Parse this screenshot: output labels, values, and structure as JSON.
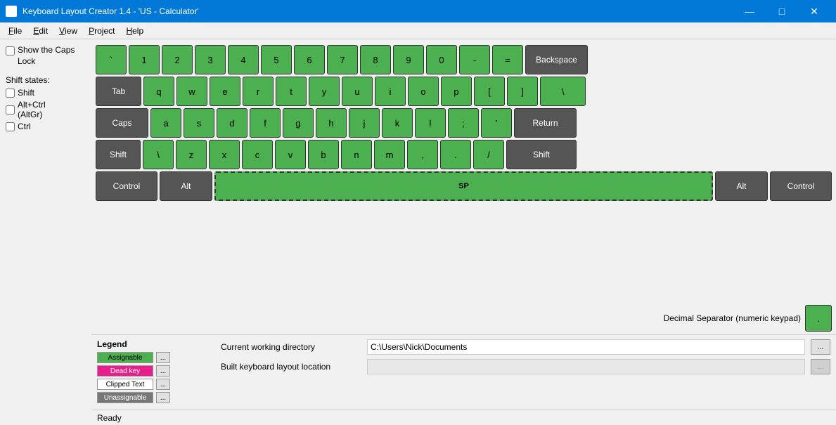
{
  "titleBar": {
    "title": "Keyboard Layout Creator 1.4 - 'US - Calculator'",
    "icon": "⌨",
    "minimize": "—",
    "maximize": "□",
    "close": "✕"
  },
  "menuBar": {
    "items": [
      {
        "label": "File",
        "underline": "F"
      },
      {
        "label": "Edit",
        "underline": "E"
      },
      {
        "label": "View",
        "underline": "V"
      },
      {
        "label": "Project",
        "underline": "P"
      },
      {
        "label": "Help",
        "underline": "H"
      }
    ]
  },
  "leftPanel": {
    "capsLock": {
      "label": "Show the Caps Lock",
      "checked": false
    },
    "shiftStates": {
      "title": "Shift states:",
      "items": [
        {
          "label": "Shift",
          "checked": false
        },
        {
          "label": "Alt+Ctrl (AltGr)",
          "checked": false
        },
        {
          "label": "Ctrl",
          "checked": false
        }
      ]
    }
  },
  "keyboard": {
    "rows": [
      {
        "keys": [
          {
            "label": "`",
            "type": "green",
            "size": "unit"
          },
          {
            "label": "1",
            "type": "green",
            "size": "unit"
          },
          {
            "label": "2",
            "type": "green",
            "size": "unit"
          },
          {
            "label": "3",
            "type": "green",
            "size": "unit"
          },
          {
            "label": "4",
            "type": "green",
            "size": "unit"
          },
          {
            "label": "5",
            "type": "green",
            "size": "unit"
          },
          {
            "label": "6",
            "type": "green",
            "size": "unit"
          },
          {
            "label": "7",
            "type": "green",
            "size": "unit"
          },
          {
            "label": "8",
            "type": "green",
            "size": "unit"
          },
          {
            "label": "9",
            "type": "green",
            "size": "unit"
          },
          {
            "label": "0",
            "type": "green",
            "size": "unit"
          },
          {
            "label": "-",
            "type": "green",
            "size": "unit"
          },
          {
            "label": "=",
            "type": "green",
            "size": "unit"
          },
          {
            "label": "Backspace",
            "type": "dark",
            "size": "backspace"
          }
        ]
      },
      {
        "keys": [
          {
            "label": "Tab",
            "type": "dark",
            "size": "tab"
          },
          {
            "label": "q",
            "type": "green",
            "size": "unit"
          },
          {
            "label": "w",
            "type": "green",
            "size": "unit"
          },
          {
            "label": "e",
            "type": "green",
            "size": "unit"
          },
          {
            "label": "r",
            "type": "green",
            "size": "unit"
          },
          {
            "label": "t",
            "type": "green",
            "size": "unit"
          },
          {
            "label": "y",
            "type": "green",
            "size": "unit"
          },
          {
            "label": "u",
            "type": "green",
            "size": "unit"
          },
          {
            "label": "i",
            "type": "green",
            "size": "unit"
          },
          {
            "label": "o",
            "type": "green",
            "size": "unit"
          },
          {
            "label": "p",
            "type": "green",
            "size": "unit"
          },
          {
            "label": "[",
            "type": "green",
            "size": "unit"
          },
          {
            "label": "]",
            "type": "green",
            "size": "unit"
          },
          {
            "label": "\\",
            "type": "green",
            "size": "backslash"
          }
        ]
      },
      {
        "keys": [
          {
            "label": "Caps",
            "type": "dark",
            "size": "caps"
          },
          {
            "label": "a",
            "type": "green",
            "size": "unit"
          },
          {
            "label": "s",
            "type": "green",
            "size": "unit"
          },
          {
            "label": "d",
            "type": "green",
            "size": "unit"
          },
          {
            "label": "f",
            "type": "green",
            "size": "unit"
          },
          {
            "label": "g",
            "type": "green",
            "size": "unit"
          },
          {
            "label": "h",
            "type": "green",
            "size": "unit"
          },
          {
            "label": "j",
            "type": "green",
            "size": "unit"
          },
          {
            "label": "k",
            "type": "green",
            "size": "unit"
          },
          {
            "label": "l",
            "type": "green",
            "size": "unit"
          },
          {
            "label": ";",
            "type": "green",
            "size": "unit"
          },
          {
            "label": "'",
            "type": "green",
            "size": "unit"
          },
          {
            "label": "Return",
            "type": "dark",
            "size": "return"
          }
        ]
      },
      {
        "keys": [
          {
            "label": "Shift",
            "type": "dark",
            "size": "shift-left"
          },
          {
            "label": "\\",
            "type": "green",
            "size": "unit"
          },
          {
            "label": "z",
            "type": "green",
            "size": "unit"
          },
          {
            "label": "x",
            "type": "green",
            "size": "unit"
          },
          {
            "label": "c",
            "type": "green",
            "size": "unit"
          },
          {
            "label": "v",
            "type": "green",
            "size": "unit"
          },
          {
            "label": "b",
            "type": "green",
            "size": "unit"
          },
          {
            "label": "n",
            "type": "green",
            "size": "unit"
          },
          {
            "label": "m",
            "type": "green",
            "size": "unit"
          },
          {
            "label": ",",
            "type": "green",
            "size": "unit"
          },
          {
            "label": ".",
            "type": "green",
            "size": "unit"
          },
          {
            "label": "/",
            "type": "green",
            "size": "unit"
          },
          {
            "label": "Shift",
            "type": "dark",
            "size": "shift-right"
          }
        ]
      },
      {
        "keys": [
          {
            "label": "Control",
            "type": "dark",
            "size": "ctrl"
          },
          {
            "label": "Alt",
            "type": "dark",
            "size": "alt"
          },
          {
            "label": "SP",
            "type": "space",
            "size": "space"
          },
          {
            "label": "Alt",
            "type": "dark",
            "size": "alt"
          },
          {
            "label": "Control",
            "type": "dark",
            "size": "ctrl"
          }
        ]
      }
    ],
    "decimalSeparator": {
      "label": "Decimal Separator (numeric keypad)",
      "key": "."
    }
  },
  "legend": {
    "title": "Legend",
    "items": [
      {
        "label": "Assignable",
        "colorClass": "assignable-color",
        "btnLabel": "..."
      },
      {
        "label": "Dead key",
        "colorClass": "deadkey-color",
        "btnLabel": "..."
      },
      {
        "label": "Clipped Text",
        "colorClass": "clipped-color",
        "btnLabel": "..."
      },
      {
        "label": "Unassignable",
        "colorClass": "unassignable-color",
        "btnLabel": "..."
      }
    ]
  },
  "directorySection": {
    "currentWorkingDir": {
      "label": "Current working directory",
      "value": "C:\\Users\\Nick\\Documents",
      "btnLabel": "..."
    },
    "builtKeyboardLayout": {
      "label": "Built keyboard layout location",
      "value": "",
      "btnLabel": "..."
    }
  },
  "statusBar": {
    "text": "Ready"
  }
}
